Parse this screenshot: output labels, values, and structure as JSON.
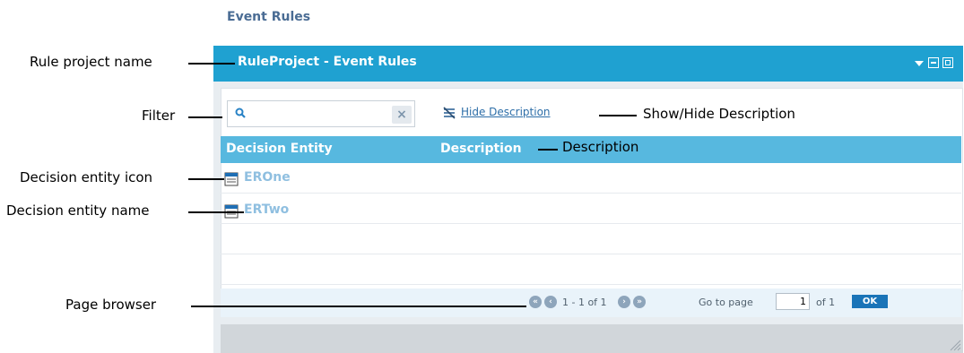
{
  "page": {
    "title": "Event Rules"
  },
  "widget": {
    "title": "RuleProject - Event Rules",
    "header_icons": [
      "collapse-arrow-icon",
      "minimize-icon",
      "maximize-icon"
    ]
  },
  "toolbar": {
    "filter_placeholder": "",
    "filter_value": "",
    "clear_symbol": "×",
    "hide_description_label": "Hide Description"
  },
  "table": {
    "columns": [
      "Decision Entity",
      "Description"
    ],
    "rows": [
      {
        "name": "EROne",
        "description": ""
      },
      {
        "name": "ERTwo",
        "description": ""
      }
    ]
  },
  "pager": {
    "range_text": "1 - 1 of 1",
    "goto_label": "Go to page",
    "page_value": "1",
    "of_total": "of 1",
    "ok_label": "OK"
  },
  "callouts": {
    "rule_project_name": "Rule project name",
    "filter": "Filter",
    "show_hide_description": "Show/Hide Description",
    "description": "Description",
    "decision_entity_icon": "Decision entity icon",
    "decision_entity_name": "Decision entity name",
    "page_browser": "Page browser"
  },
  "colors": {
    "header": "#1fa1d1",
    "column_header": "#57b8df",
    "entity_link": "#8fbfe0",
    "ok_button": "#1a74b8"
  }
}
